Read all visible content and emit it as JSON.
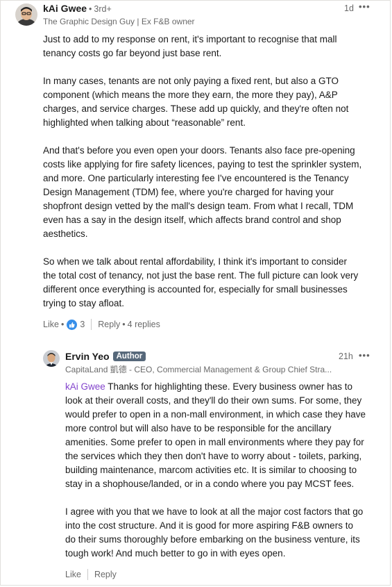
{
  "comment": {
    "author": "kAi Gwee",
    "degree": "3rd+",
    "headline": "The Graphic Design Guy | Ex F&B owner",
    "time": "1d",
    "paragraphs": [
      [
        "Just to add to my response on rent, it's important to recognise that mall",
        "tenancy costs go far beyond just base rent."
      ],
      [
        "In many cases, tenants are not only paying a fixed rent, but also a GTO",
        "component (which means the more they earn, the more they pay), A&P",
        "charges, and service charges. These add up quickly, and they're often not",
        "highlighted when talking about “reasonable” rent."
      ],
      [
        "And that's before you even open your doors. Tenants also face pre-opening",
        "costs like applying for fire safety licences, paying to test the sprinkler system,",
        "and more. One particularly interesting fee I've encountered is the Tenancy",
        "Design Management (TDM) fee, where you're charged for having your",
        "shopfront design vetted by the mall's design team. From what I recall, TDM",
        "even has a say in the design itself, which affects brand control and shop",
        "aesthetics."
      ],
      [
        "So when we talk about rental affordability, I think it's important to consider",
        "the total cost of tenancy, not just the base rent. The full picture can look very",
        "different once everything is accounted for, especially for small businesses",
        "trying to stay afloat."
      ]
    ],
    "like_label": "Like",
    "like_count": "3",
    "reply_label": "Reply",
    "replies_count": "4 replies"
  },
  "reply": {
    "author": "Ervin Yeo",
    "badge": "Author",
    "headline": "CapitaLand 凱德 - CEO, Commercial Management & Group Chief Stra...",
    "time": "21h",
    "mention": "kAi Gwee",
    "paragraphs": [
      [
        " Thanks for highlighting these. Every business owner has to",
        "look at their overall costs, and they'll do their own sums. For some, they",
        "would prefer to open in a non-mall environment, in which case they have",
        "more control but will also have to be responsible for the ancillary",
        "amenities. Some prefer to open in mall environments where they pay for",
        "the services which they then don't have to worry about - toilets, parking,",
        "building maintenance, marcom activities etc. It is similar to choosing to",
        "stay in a shophouse/landed, or in a condo where you pay MCST fees."
      ],
      [
        "I agree with you that we have to look at all the major cost factors that go",
        "into the cost structure. And it is good for more aspiring F&B owners to",
        "do their sums thoroughly before embarking on the business venture, its",
        "tough work! And much better to go in with eyes open."
      ]
    ],
    "like_label": "Like",
    "reply_label": "Reply"
  },
  "icons": {
    "more": "more-horizontal-icon",
    "reaction": "thumbs-up-reaction-icon"
  },
  "colors": {
    "mention": "#8344cc",
    "badge": "#56687a",
    "reaction": "#378fe9"
  }
}
